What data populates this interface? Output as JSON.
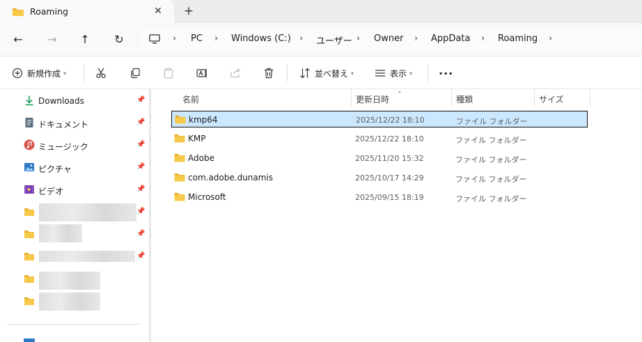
{
  "tab": {
    "title": "Roaming",
    "close": "✕",
    "new_tab": "+"
  },
  "nav": {
    "back": "←",
    "forward": "→",
    "up": "↑",
    "refresh": "↻"
  },
  "breadcrumbs": [
    "PC",
    "Windows (C:)",
    "ユーザー",
    "Owner",
    "AppData",
    "Roaming"
  ],
  "breadcrumb_separator": "›",
  "commands": {
    "new_label": "新規作成",
    "sort_label": "並べ替え",
    "view_label": "表示",
    "more": "···"
  },
  "sidebar": {
    "items": [
      {
        "label": "Downloads",
        "icon": "download-icon"
      },
      {
        "label": "ドキュメント",
        "icon": "document-icon"
      },
      {
        "label": "ミュージック",
        "icon": "music-icon"
      },
      {
        "label": "ピクチャ",
        "icon": "pictures-icon"
      },
      {
        "label": "ビデオ",
        "icon": "video-icon"
      }
    ],
    "pin_glyph": "📌"
  },
  "columns": {
    "name": "名前",
    "date": "更新日時",
    "type": "種類",
    "size": "サイズ"
  },
  "files": [
    {
      "name": "kmp64",
      "date": "2025/12/22 18:10",
      "type": "ファイル フォルダー",
      "size": "",
      "selected": true
    },
    {
      "name": "KMP",
      "date": "2025/12/22 18:10",
      "type": "ファイル フォルダー",
      "size": "",
      "selected": false
    },
    {
      "name": "Adobe",
      "date": "2025/11/20 15:32",
      "type": "ファイル フォルダー",
      "size": "",
      "selected": false
    },
    {
      "name": "com.adobe.dunamis",
      "date": "2025/10/17 14:29",
      "type": "ファイル フォルダー",
      "size": "",
      "selected": false
    },
    {
      "name": "Microsoft",
      "date": "2025/09/15 18:19",
      "type": "ファイル フォルダー",
      "size": "",
      "selected": false
    }
  ],
  "colors": {
    "folder": "#f7c948",
    "folder_dark": "#e9ab2b",
    "selection": "#cce8ff",
    "accent": "#0067c0"
  }
}
